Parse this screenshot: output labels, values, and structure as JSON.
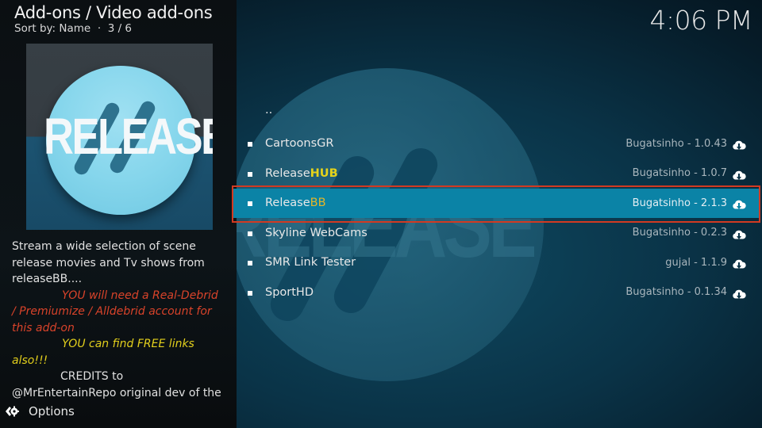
{
  "header": {
    "title": "Add-ons / Video add-ons",
    "sort_label": "Sort by: Name",
    "separator": "·",
    "position": "3 / 6"
  },
  "clock": "4:06 PM",
  "thumbnail": {
    "logo_text": "RELEASE"
  },
  "fanart": {
    "word": "RELEASE"
  },
  "description": {
    "line1": "Stream a wide selection of scene",
    "line2": "release movies and Tv shows from",
    "line3": "releaseBB....",
    "red1": "YOU will need a Real-Debrid",
    "red2": "/ Premiumize / Alldebrid account for",
    "red3": "this add-on",
    "yellow1": "YOU can find FREE links",
    "yellow2": "also!!!",
    "credits": "CREDITS to",
    "credits2": "@MrEntertainRepo original dev of the"
  },
  "options_label": "Options",
  "colors": {
    "selection": "#0b83a6",
    "focus_border": "#d23a22",
    "highlight_yellow": "#e6d31a",
    "highlight_gold": "#e3b52a",
    "warning_red": "#d9432a",
    "note_yellow": "#e2cf1c"
  },
  "list": {
    "parent": "..",
    "items": [
      {
        "name": "CartoonsGR",
        "name_plain": "CartoonsGR",
        "name_hl": "",
        "author_version": "Bugatsinho - 1.0.43",
        "icon": "cloud-download-icon"
      },
      {
        "name": "ReleaseHUB",
        "name_plain": "Release",
        "name_hl": "HUB",
        "author_version": "Bugatsinho - 1.0.7",
        "icon": "cloud-download-icon"
      },
      {
        "name": "ReleaseBB",
        "name_plain": "Release",
        "name_hl": "BB",
        "author_version": "Bugatsinho - 2.1.3",
        "icon": "cloud-download-icon",
        "selected": true
      },
      {
        "name": "Skyline WebCams",
        "name_plain": "Skyline WebCams",
        "name_hl": "",
        "author_version": "Bugatsinho - 0.2.3",
        "icon": "cloud-download-icon"
      },
      {
        "name": "SMR Link Tester",
        "name_plain": "SMR Link Tester",
        "name_hl": "",
        "author_version": "gujal - 1.1.9",
        "icon": "cloud-download-icon"
      },
      {
        "name": "SportHD",
        "name_plain": "SportHD",
        "name_hl": "",
        "author_version": "Bugatsinho - 0.1.34",
        "icon": "cloud-download-icon"
      }
    ]
  }
}
